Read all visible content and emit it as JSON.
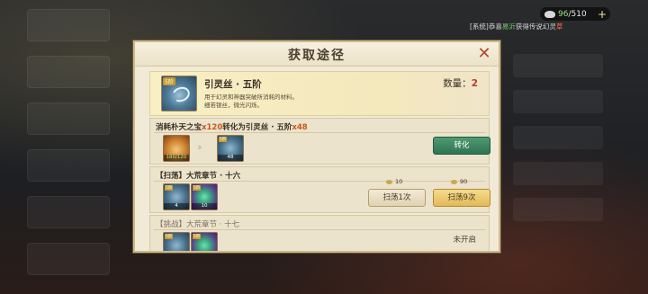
{
  "hud": {
    "currency_value": "96",
    "currency_max": "/510",
    "plus": "+",
    "system_prefix": "[系统]恭喜",
    "system_player": "易沂",
    "system_mid": "获得传说幻灵",
    "system_tail": "草"
  },
  "dialog": {
    "title": "获取途径",
    "item": {
      "tier_badge": "5阶",
      "name": "引灵丝 · 五阶",
      "quantity_label": "数量：",
      "quantity_value": "2",
      "desc_line1": "用于幻灵和神器突破所消耗的材料。",
      "desc_line2": "细若银丝，微光闪烁。"
    },
    "convert": {
      "head_prefix": "消耗朴天之宝",
      "head_cost": "x120",
      "head_mid": "转化为引灵丝 · 五阶",
      "head_gain": "x48",
      "source_count": "180/120",
      "target_count": "48",
      "button": "转化"
    },
    "sweep16": {
      "head": "【扫荡】大荒章节 · 十六",
      "slot1_count": "4",
      "slot2_count": "10",
      "cost1": "10",
      "cost2": "90",
      "btn1": "扫荡1次",
      "btn2": "扫荡9次"
    },
    "challenge17": {
      "head": "【挑战】大荒章节 · 十七",
      "status": "未开启"
    }
  }
}
